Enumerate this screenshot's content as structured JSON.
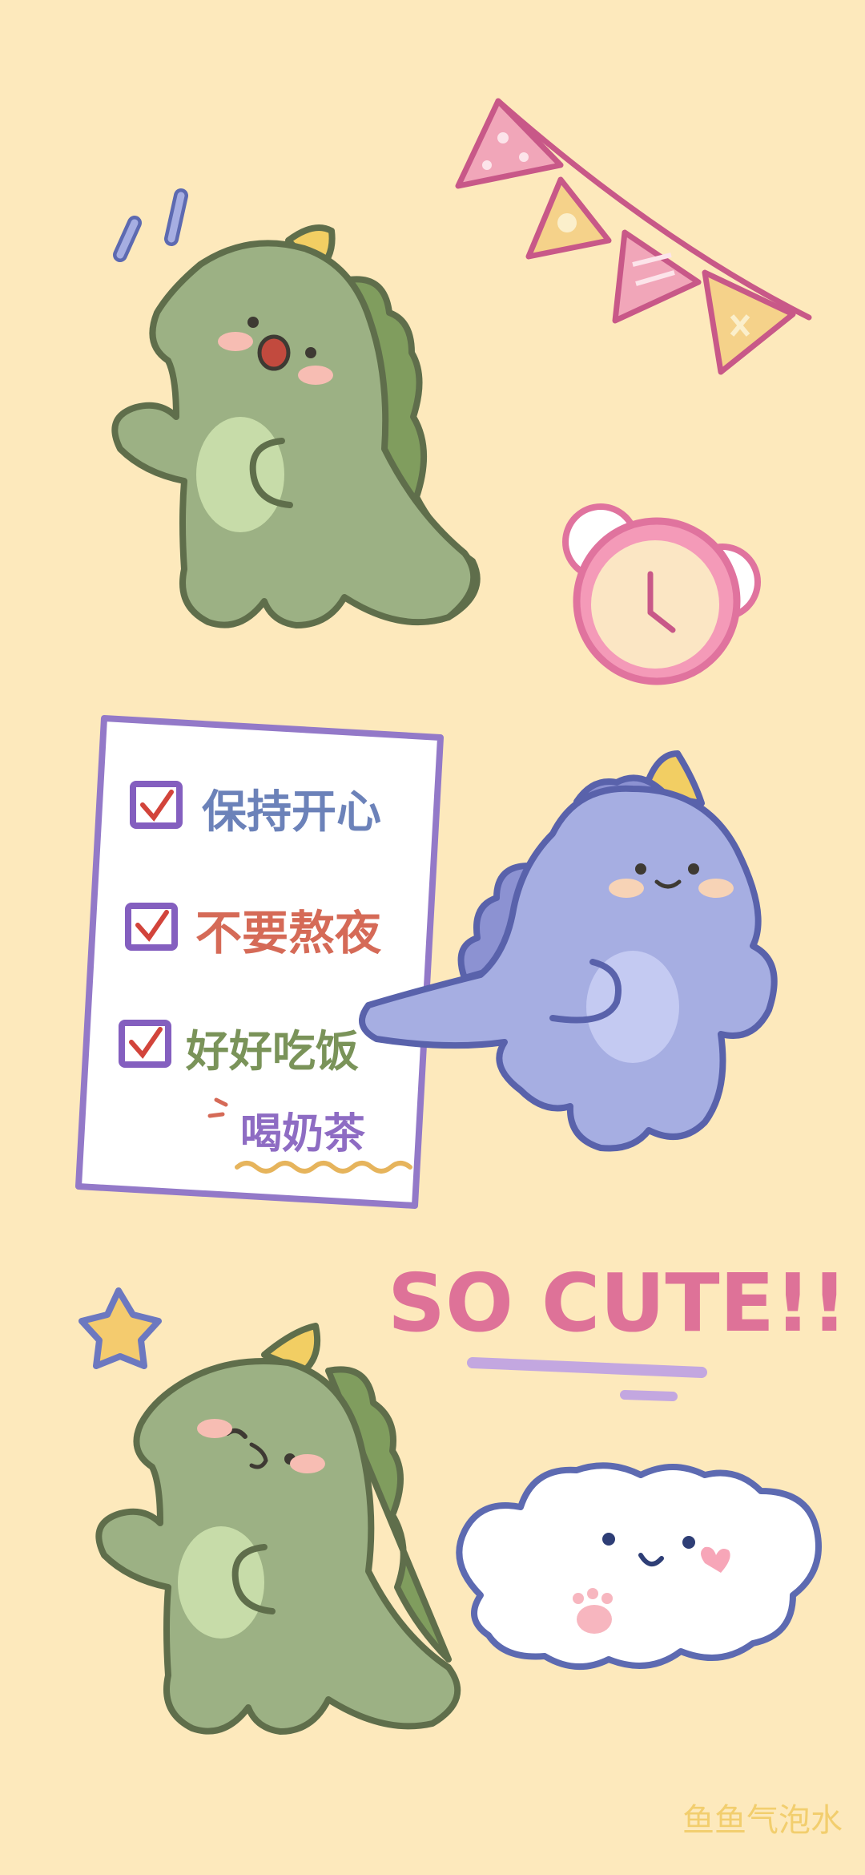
{
  "wallpaper": {
    "background_color": "#FDE9BC",
    "colors": {
      "green_dino": "#9CB184",
      "green_outline": "#5F6E4B",
      "green_belly": "#C7DCA9",
      "green_spikes": "#809D5E",
      "purple_dino": "#A6AEE2",
      "purple_outline": "#5962AB",
      "purple_belly": "#C4CAF2",
      "purple_spikes": "#8C92D2",
      "horn_yellow": "#F2CE63",
      "blush_pink": "#F7BDB3",
      "clock_pink": "#E0739E",
      "flag_outline": "#C85888",
      "note_border": "#9379C8",
      "checkbox_color": "#845FBF",
      "check_red": "#D2443B",
      "cute_pink": "#DE7298",
      "cloud_outline": "#5D6AB1",
      "star_yellow": "#F4CB6E"
    },
    "icons": [
      "dinosaur-green",
      "dinosaur-purple",
      "bunting-flags",
      "alarm-clock",
      "checklist-note",
      "star",
      "cloud-face"
    ]
  },
  "checklist": {
    "items": [
      {
        "label": "保持开心",
        "checked": true,
        "color": "#6C82B9"
      },
      {
        "label": "不要熬夜",
        "checked": true,
        "color": "#D56A57"
      },
      {
        "label": "好好吃饭",
        "checked": true,
        "color": "#7A9359"
      }
    ],
    "extra": {
      "label": "喝奶茶",
      "color": "#8E6CC3"
    }
  },
  "slogan": {
    "text": "SO CUTE!!"
  },
  "watermark": {
    "text": "鱼鱼气泡水"
  }
}
